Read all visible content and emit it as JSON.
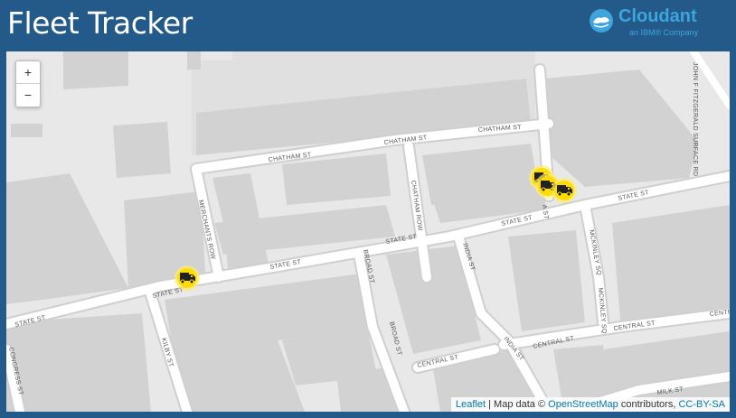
{
  "header": {
    "title": "Fleet Tracker",
    "logo": {
      "wordmark": "Cloudant",
      "tagline": "an IBM® Company",
      "icon": "cloudant-logo-icon",
      "color": "#3ea4dc"
    },
    "background": "#245a8a"
  },
  "map": {
    "zoom_in_label": "+",
    "zoom_out_label": "−",
    "streets": [
      "JOHN F FITZGERALD SURFACE RD",
      "CHATHAM ST",
      "CHATHAM ST",
      "CHATHAM ST",
      "CHATHAM ROW",
      "MERCHANTS ROW",
      "STATE ST",
      "STATE ST",
      "STATE ST",
      "STATE ST",
      "STATE ST",
      "STATE ST",
      "BROAD ST",
      "BROAD ST",
      "INDIA ST",
      "INDIA ST",
      "MCKINLEY SQ",
      "MCKINLEY SQ",
      "CENTRAL ST",
      "CENTRAL ST",
      "CENTRAL ST",
      "CENTRAL ST",
      "KILBY ST",
      "CONGRESS ST",
      "MILK ST",
      "A ST"
    ],
    "marker_icon": "truck-icon",
    "marker_color": "#ffdd00",
    "marker_count": 4,
    "attribution": {
      "leaflet": "Leaflet",
      "sep1": " | Map data © ",
      "osm": "OpenStreetMap",
      "sep2": " contributors, ",
      "license": "CC-BY-SA"
    }
  }
}
